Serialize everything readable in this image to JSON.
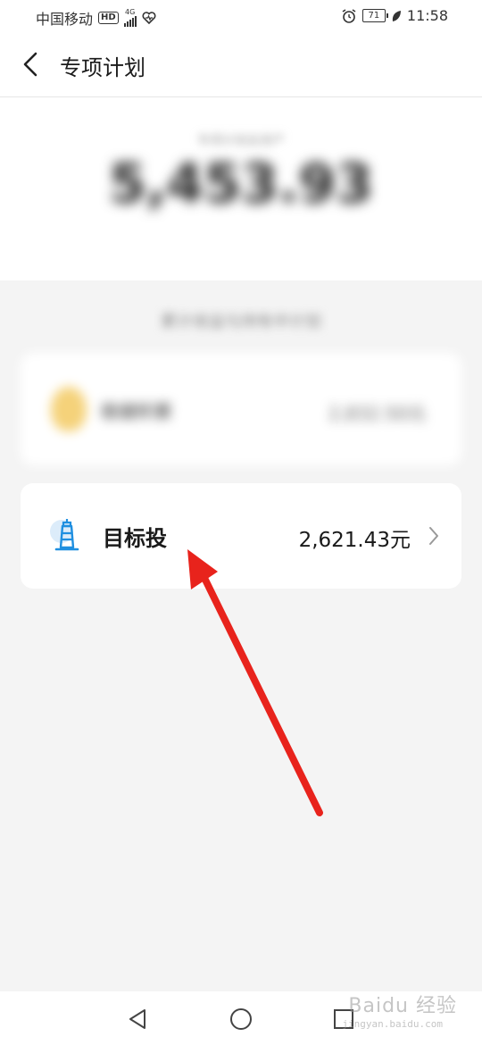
{
  "status_bar": {
    "carrier": "中国移动",
    "hd_badge": "HD",
    "network_type": "4G",
    "battery_level": "71",
    "time": "11:58",
    "icons": [
      "hd-badge",
      "signal-icon",
      "heart-health-icon",
      "alarm-icon",
      "battery-icon",
      "leaf-icon"
    ]
  },
  "header": {
    "title": "专项计划",
    "back_icon": "chevron-left-icon"
  },
  "hero": {
    "caption_blurred": "专项计划总资产",
    "amount_blurred": "5,453.93"
  },
  "section_hint_blurred": "累计收益与持有中计划",
  "plans": [
    {
      "name_blurred": "稳健积累",
      "amount_blurred": "2,832.50元",
      "icon": "bulb-icon",
      "blurred": true
    },
    {
      "name": "目标投",
      "amount": "2,621.43元",
      "icon": "lighthouse-icon",
      "chevron_icon": "chevron-right-icon",
      "blurred": false
    }
  ],
  "annotation": {
    "arrow_color": "#e8231c"
  },
  "nav_bar": {
    "icons": [
      "nav-back-icon",
      "nav-home-icon",
      "nav-recents-icon"
    ]
  },
  "watermark": {
    "text": "Baidu 经验",
    "sub": "jingyan.baidu.com"
  },
  "colors": {
    "accent_blue": "#1f8fe0",
    "background": "#f4f4f4",
    "card": "#ffffff"
  }
}
